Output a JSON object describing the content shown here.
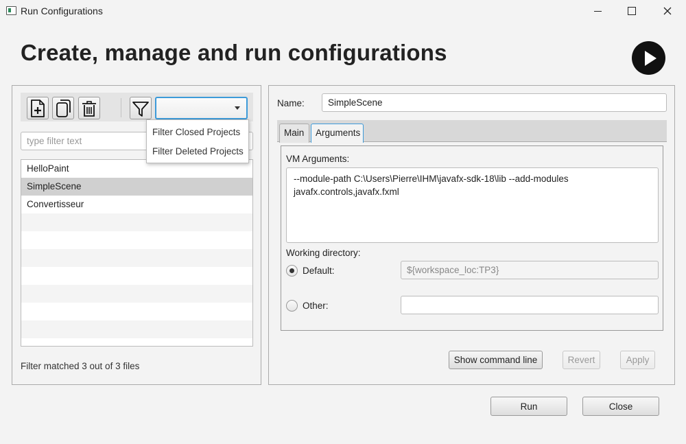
{
  "window": {
    "title": "Run Configurations"
  },
  "header": {
    "title": "Create, manage and run configurations"
  },
  "left_panel": {
    "toolbar": {
      "buttons": [
        "new-config-icon",
        "duplicate-icon",
        "delete-icon",
        "filter-icon"
      ],
      "filter_combo_value": ""
    },
    "filter_placeholder": "type filter text",
    "filter_dropdown": {
      "options": [
        "Filter Closed Projects",
        "Filter Deleted Projects"
      ]
    },
    "configs": [
      {
        "label": "HelloPaint"
      },
      {
        "label": "SimpleScene",
        "selected": true
      },
      {
        "label": "Convertisseur"
      }
    ],
    "status": "Filter matched 3 out of 3 files"
  },
  "right_panel": {
    "name_label": "Name:",
    "name_value": "SimpleScene",
    "tabs": [
      {
        "label": "Main"
      },
      {
        "label": "Arguments",
        "active": true
      }
    ],
    "vm_args_label": "VM Arguments:",
    "vm_args_lines": [
      "--module-path C:\\Users\\Pierre\\IHM\\javafx-sdk-18\\lib --add-modules",
      "javafx.controls,javafx.fxml"
    ],
    "working_dir_label": "Working directory:",
    "default_label": "Default:",
    "default_value": "${workspace_loc:TP3}",
    "other_label": "Other:",
    "other_value": "",
    "buttons": {
      "show_command_line": "Show command line",
      "revert": "Revert",
      "apply": "Apply"
    }
  },
  "footer": {
    "run": "Run",
    "close": "Close"
  },
  "colors": {
    "focus_accent": "#3c9ad9",
    "selection": "#d0d0d0",
    "run_circle": "#111111"
  }
}
